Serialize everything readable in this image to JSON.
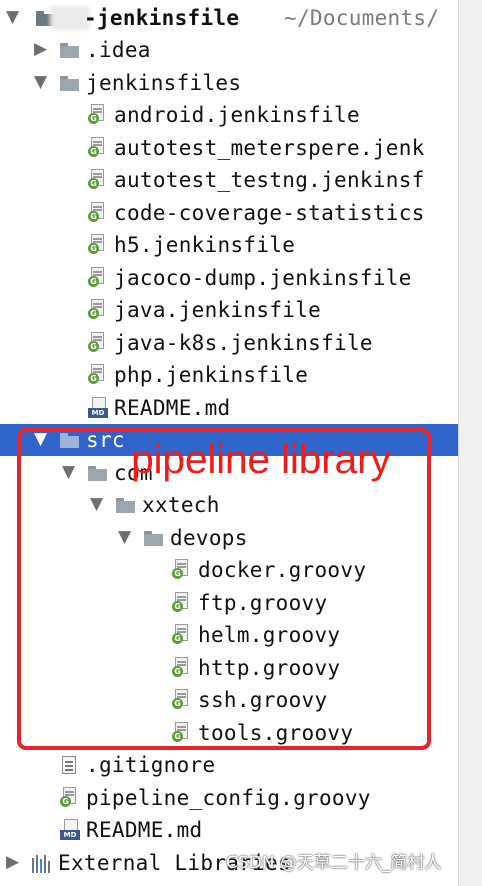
{
  "tree": {
    "root": {
      "name": "-jenkinsfile",
      "path": "~/Documents/"
    },
    "items": [
      {
        "label": ".idea",
        "type": "folder"
      },
      {
        "label": "jenkinsfiles",
        "type": "folder"
      },
      {
        "label": "android.jenkinsfile",
        "type": "groovy"
      },
      {
        "label": "autotest_meterspere.jenk",
        "type": "groovy"
      },
      {
        "label": "autotest_testng.jenkinsf",
        "type": "groovy"
      },
      {
        "label": "code-coverage-statistics",
        "type": "groovy"
      },
      {
        "label": "h5.jenkinsfile",
        "type": "groovy"
      },
      {
        "label": "jacoco-dump.jenkinsfile",
        "type": "groovy"
      },
      {
        "label": "java.jenkinsfile",
        "type": "groovy"
      },
      {
        "label": "java-k8s.jenkinsfile",
        "type": "groovy"
      },
      {
        "label": "php.jenkinsfile",
        "type": "groovy"
      },
      {
        "label": "README.md",
        "type": "md"
      },
      {
        "label": "src",
        "type": "folder",
        "selected": true
      },
      {
        "label": "com",
        "type": "folder"
      },
      {
        "label": "xxtech",
        "type": "folder"
      },
      {
        "label": "devops",
        "type": "folder"
      },
      {
        "label": "docker.groovy",
        "type": "groovy"
      },
      {
        "label": "ftp.groovy",
        "type": "groovy"
      },
      {
        "label": "helm.groovy",
        "type": "groovy"
      },
      {
        "label": "http.groovy",
        "type": "groovy"
      },
      {
        "label": "ssh.groovy",
        "type": "groovy"
      },
      {
        "label": "tools.groovy",
        "type": "groovy"
      },
      {
        "label": ".gitignore",
        "type": "text"
      },
      {
        "label": "pipeline_config.groovy",
        "type": "groovy"
      },
      {
        "label": "README.md",
        "type": "md"
      },
      {
        "label": "External Libraries",
        "type": "library"
      }
    ]
  },
  "icons": {
    "folder": "folder-icon",
    "groovy": "groovy-file-icon",
    "md": "markdown-file-icon",
    "text": "text-file-icon",
    "library": "external-libraries-icon",
    "expanded": "chevron-down-icon",
    "collapsed": "chevron-right-icon"
  },
  "annotation": {
    "text": "pipeline library",
    "color": "#e8232a"
  },
  "watermark": {
    "text": "CSDN @天草二十六_简村人"
  },
  "colors": {
    "selection": "#2f65ca",
    "groovy_badge": "#5b9b3a"
  }
}
